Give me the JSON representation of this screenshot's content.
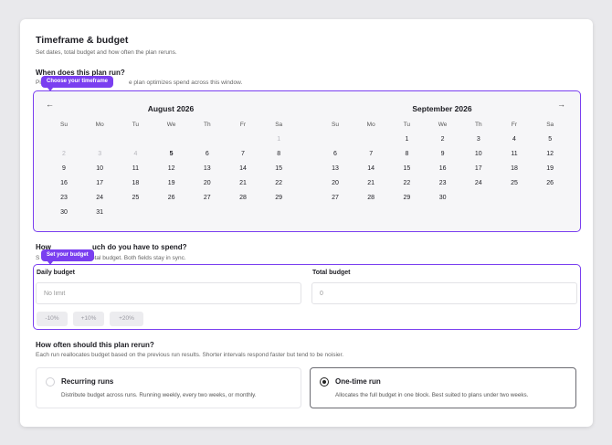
{
  "header": {
    "title": "Timeframe & budget",
    "subtitle": "Set dates, total budget and how often the plan reruns."
  },
  "timeframe": {
    "question": "When does this plan run?",
    "hint": "Pi",
    "hint_tail": "e plan optimizes spend across this window.",
    "tooltip": "Choose your timeframe",
    "weekdays": [
      "Su",
      "Mo",
      "Tu",
      "We",
      "Th",
      "Fr",
      "Sa"
    ],
    "prev_icon": "←",
    "next_icon": "→",
    "months": [
      {
        "name": "August 2026",
        "weeks": [
          [
            null,
            null,
            null,
            null,
            null,
            null,
            {
              "d": "1",
              "s": "muted"
            }
          ],
          [
            {
              "d": "2",
              "s": "muted"
            },
            {
              "d": "3",
              "s": "muted"
            },
            {
              "d": "4",
              "s": "muted"
            },
            {
              "d": "5",
              "s": "bold"
            },
            {
              "d": "6"
            },
            {
              "d": "7"
            },
            {
              "d": "8"
            }
          ],
          [
            {
              "d": "9"
            },
            {
              "d": "10"
            },
            {
              "d": "11"
            },
            {
              "d": "12"
            },
            {
              "d": "13"
            },
            {
              "d": "14"
            },
            {
              "d": "15"
            }
          ],
          [
            {
              "d": "16"
            },
            {
              "d": "17"
            },
            {
              "d": "18"
            },
            {
              "d": "19"
            },
            {
              "d": "20"
            },
            {
              "d": "21"
            },
            {
              "d": "22"
            }
          ],
          [
            {
              "d": "23"
            },
            {
              "d": "24"
            },
            {
              "d": "25"
            },
            {
              "d": "26"
            },
            {
              "d": "27"
            },
            {
              "d": "28"
            },
            {
              "d": "29"
            }
          ],
          [
            {
              "d": "30"
            },
            {
              "d": "31"
            },
            null,
            null,
            null,
            null,
            null
          ]
        ]
      },
      {
        "name": "September 2026",
        "weeks": [
          [
            null,
            null,
            {
              "d": "1"
            },
            {
              "d": "2"
            },
            {
              "d": "3"
            },
            {
              "d": "4"
            },
            {
              "d": "5"
            }
          ],
          [
            {
              "d": "6"
            },
            {
              "d": "7"
            },
            {
              "d": "8"
            },
            {
              "d": "9"
            },
            {
              "d": "10"
            },
            {
              "d": "11"
            },
            {
              "d": "12"
            }
          ],
          [
            {
              "d": "13"
            },
            {
              "d": "14"
            },
            {
              "d": "15"
            },
            {
              "d": "16"
            },
            {
              "d": "17"
            },
            {
              "d": "18"
            },
            {
              "d": "19"
            }
          ],
          [
            {
              "d": "20"
            },
            {
              "d": "21"
            },
            {
              "d": "22"
            },
            {
              "d": "23"
            },
            {
              "d": "24"
            },
            {
              "d": "25"
            },
            {
              "d": "26"
            }
          ],
          [
            {
              "d": "27"
            },
            {
              "d": "28"
            },
            {
              "d": "29"
            },
            {
              "d": "30"
            },
            null,
            null,
            null
          ]
        ]
      }
    ]
  },
  "budget": {
    "question_left": "How",
    "question_right": "uch do you have to spend?",
    "hint_lead": "S",
    "hint_tail": "otal budget. Both fields stay in sync.",
    "tooltip": "Set your budget",
    "daily_label": "Daily budget",
    "daily_placeholder": "No limit",
    "total_label": "Total budget",
    "total_placeholder": "0",
    "adjust_minus": "-10%",
    "adjust_plus10": "+10%",
    "adjust_plus20": "+20%"
  },
  "rerun": {
    "question": "How often should this plan rerun?",
    "hint": "Each run reallocates budget based on the previous run results. Shorter intervals respond faster but tend to be noisier.",
    "options": [
      {
        "title": "Recurring runs",
        "desc": "Distribute budget across runs. Running weekly, every two weeks, or monthly."
      },
      {
        "title": "One-time run",
        "desc": "Allocates the full budget in one block. Best suited to plans under two weeks."
      }
    ]
  },
  "colors": {
    "accent": "#7a3ff0"
  }
}
